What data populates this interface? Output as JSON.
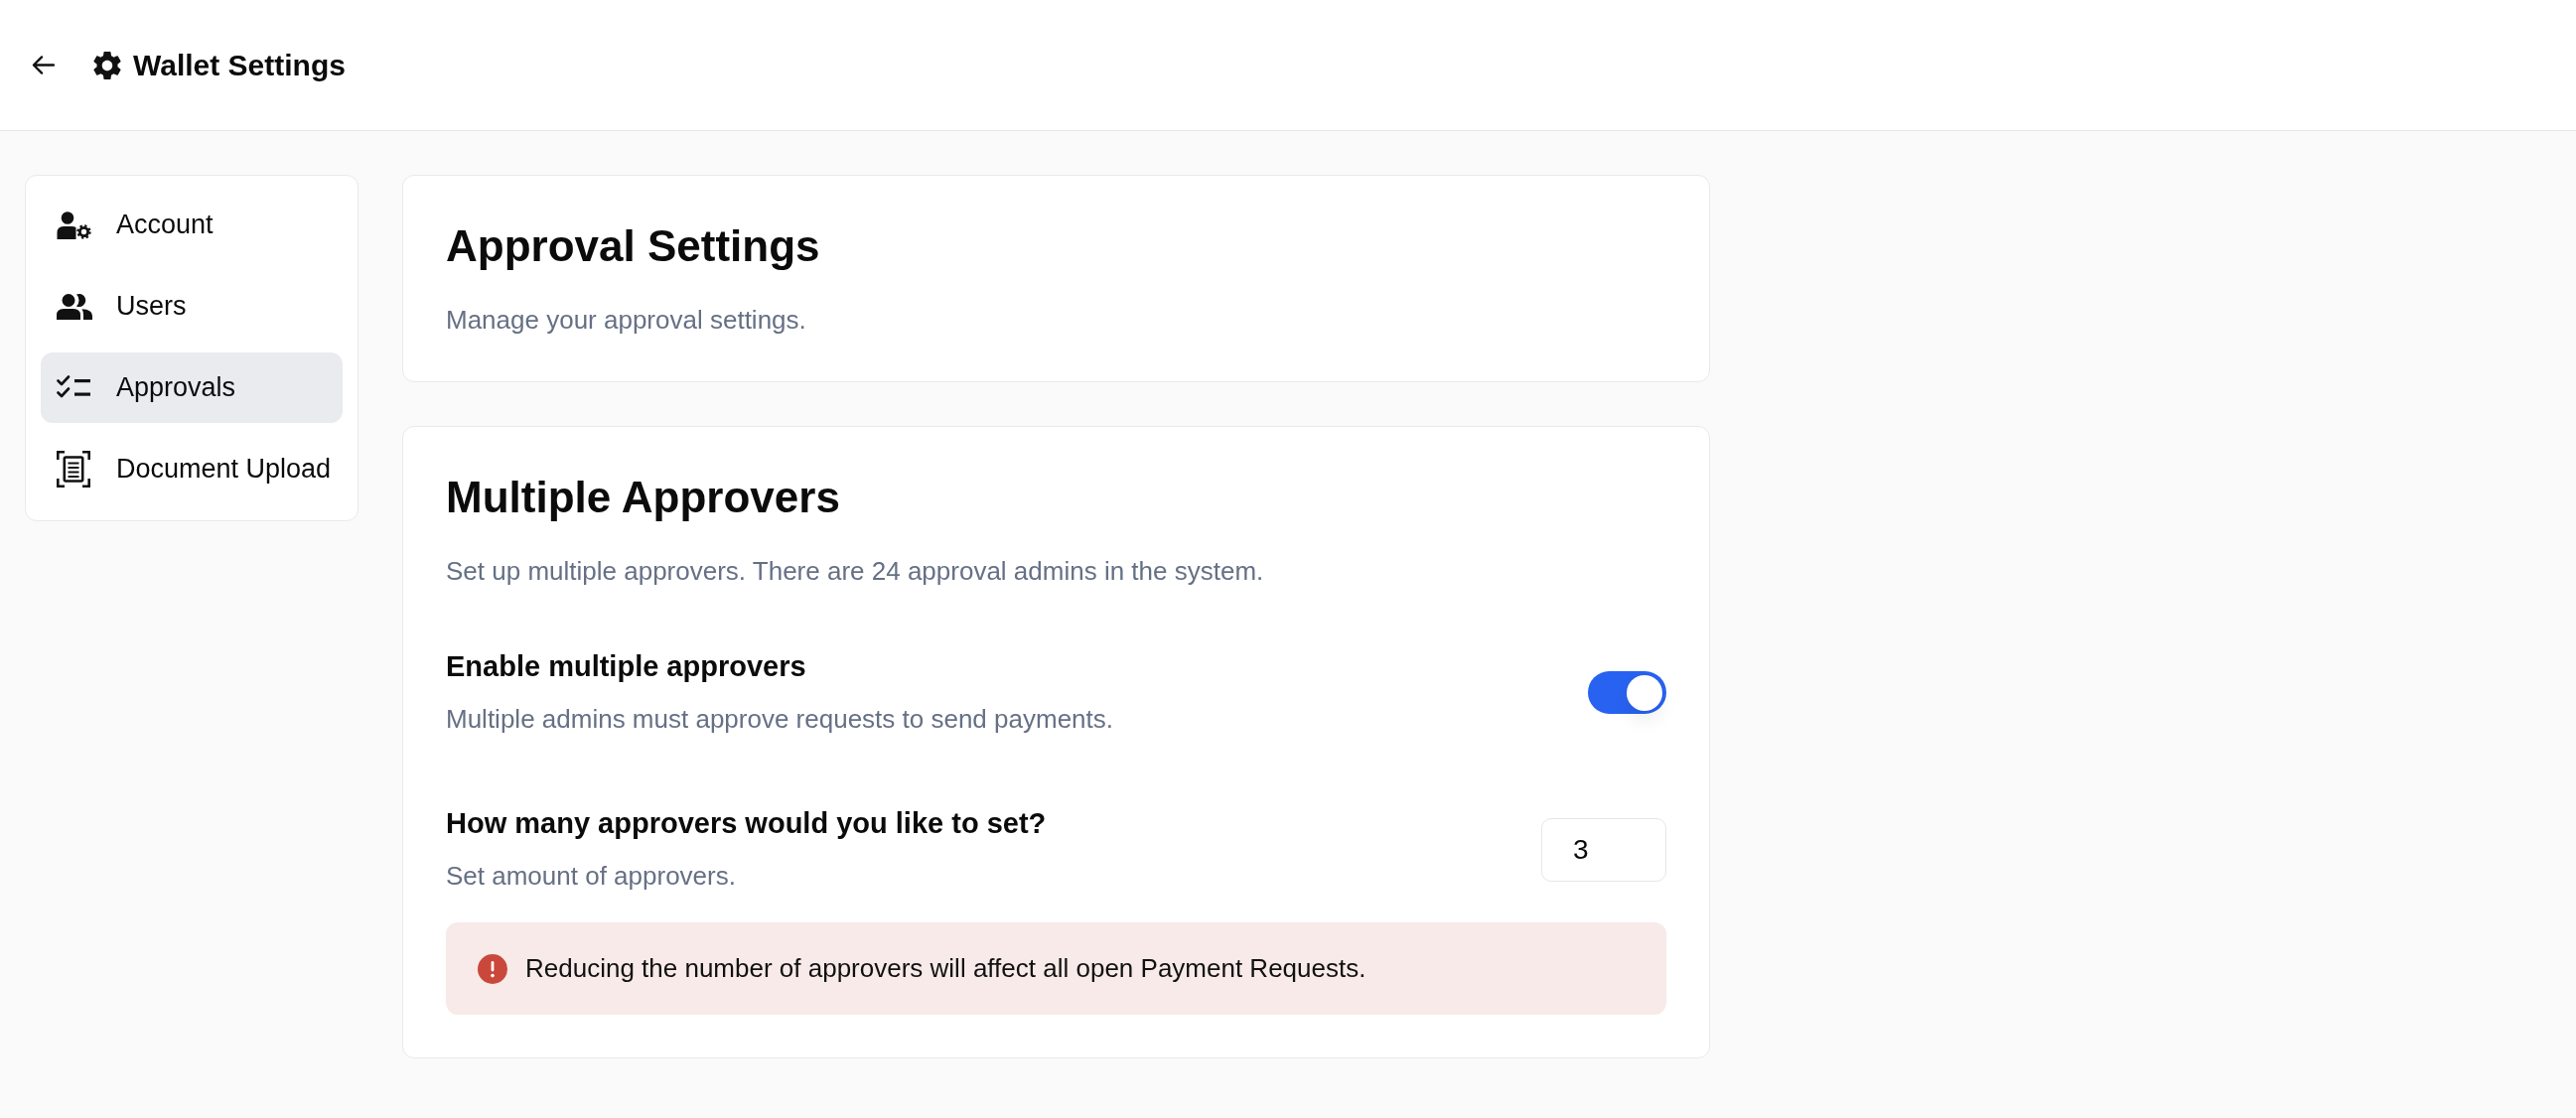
{
  "header": {
    "title": "Wallet Settings"
  },
  "sidebar": {
    "items": [
      {
        "label": "Account",
        "selected": false
      },
      {
        "label": "Users",
        "selected": false
      },
      {
        "label": "Approvals",
        "selected": true
      },
      {
        "label": "Document Upload",
        "selected": false
      }
    ]
  },
  "approval_settings": {
    "title": "Approval Settings",
    "description": "Manage your approval settings."
  },
  "multiple_approvers": {
    "title": "Multiple Approvers",
    "description": "Set up multiple approvers. There are 24 approval admins in the system.",
    "settings": [
      {
        "kind": "toggle",
        "label": "Enable multiple approvers",
        "description": "Multiple admins must approve requests to send payments.",
        "on": true
      },
      {
        "kind": "number",
        "label": "How many approvers would you like to set?",
        "description": "Set amount of approvers.",
        "value": "3"
      }
    ],
    "alert": {
      "text": "Reducing the number of approvers will affect all open Payment Requests."
    }
  }
}
